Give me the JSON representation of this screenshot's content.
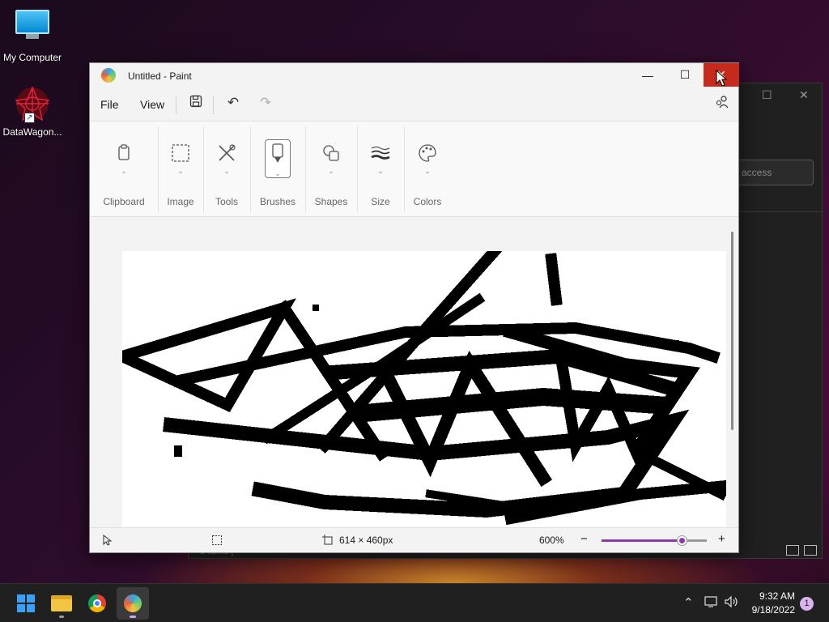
{
  "desktop": {
    "icons": [
      {
        "label": "My Computer"
      },
      {
        "label": "DataWagon..."
      }
    ]
  },
  "background_window": {
    "search_placeholder": "access",
    "status_text": "0 items  |"
  },
  "paint": {
    "title": "Untitled - Paint",
    "menu": {
      "file": "File",
      "view": "View"
    },
    "ribbon": [
      {
        "label": "Clipboard",
        "icon": "clipboard-icon"
      },
      {
        "label": "Image",
        "icon": "selection-icon"
      },
      {
        "label": "Tools",
        "icon": "tools-icon"
      },
      {
        "label": "Brushes",
        "icon": "brush-icon"
      },
      {
        "label": "Shapes",
        "icon": "shapes-icon"
      },
      {
        "label": "Size",
        "icon": "size-icon"
      },
      {
        "label": "Colors",
        "icon": "palette-icon"
      }
    ],
    "status": {
      "canvas_size": "614 × 460px",
      "zoom": "600%",
      "zoom_fraction": 0.78
    },
    "colors": {
      "accent": "#8e3aa6",
      "close_hover": "#c42b1c"
    }
  },
  "taskbar": {
    "apps": [
      "start",
      "file-explorer",
      "chrome",
      "paint"
    ],
    "time": "9:32 AM",
    "date": "9/18/2022",
    "notification_count": "1"
  }
}
